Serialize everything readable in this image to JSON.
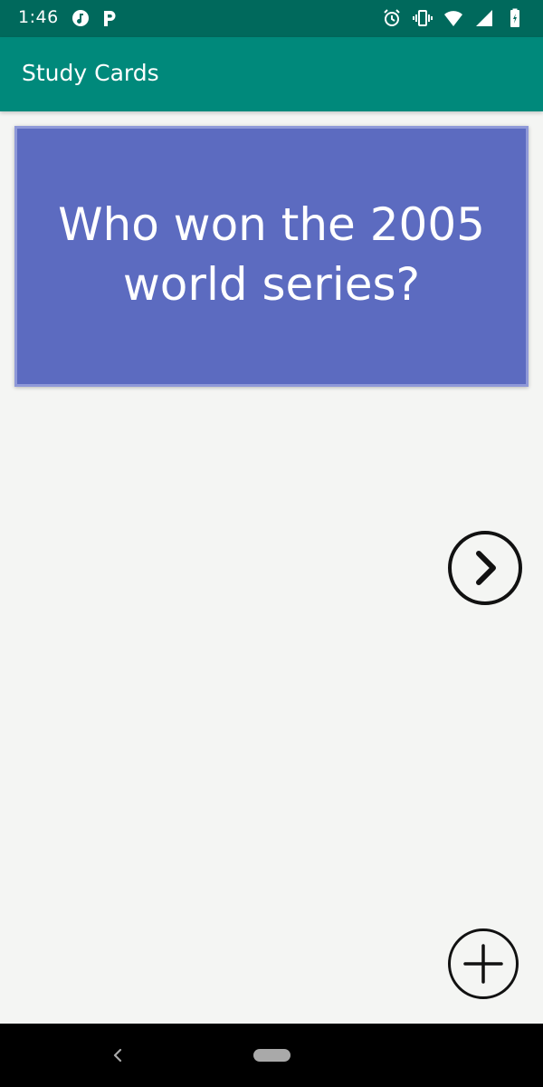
{
  "status_bar": {
    "time": "1:46",
    "left_icons": [
      "music-notification-icon",
      "parking-p-icon"
    ],
    "right_icons": [
      "alarm-icon",
      "vibrate-icon",
      "wifi-icon",
      "signal-icon",
      "battery-icon"
    ]
  },
  "app_bar": {
    "title": "Study Cards"
  },
  "card": {
    "question": "Who won the 2005 world series?"
  },
  "buttons": {
    "next_icon": "chevron-right-circle-icon",
    "add_icon": "plus-circle-icon"
  },
  "colors": {
    "status_bar": "#00695c",
    "app_bar": "#00897b",
    "card": "#5c6bc0",
    "background": "#f4f5f3"
  }
}
